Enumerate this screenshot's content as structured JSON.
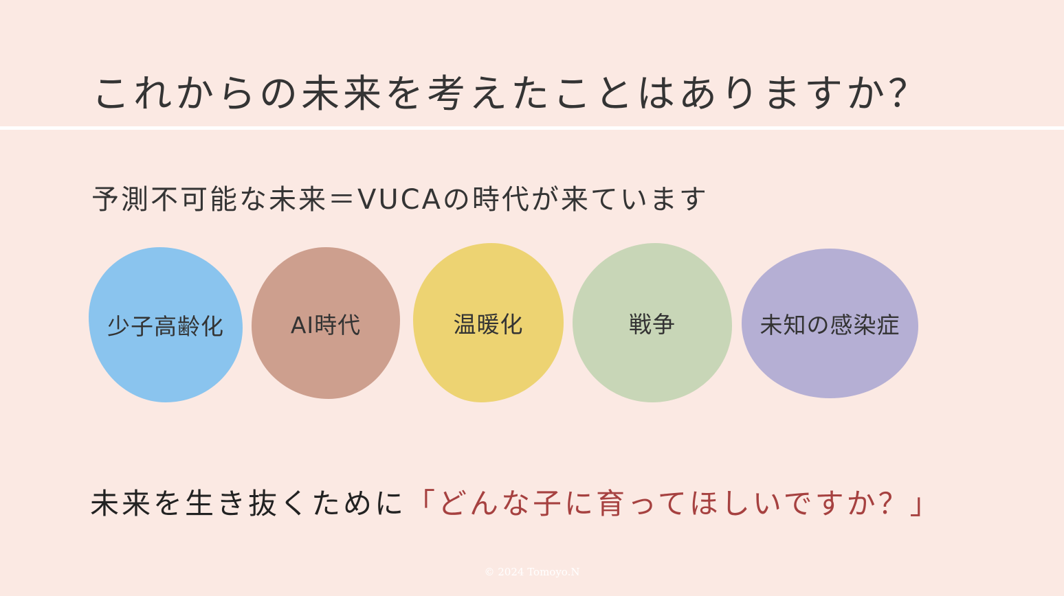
{
  "slide": {
    "title": "これからの未来を考えたことはありますか？",
    "subtitle": "予測不可能な未来＝VUCAの時代が来ています",
    "blobs": [
      {
        "label": "少子高齢化",
        "color": "#8ac4ee"
      },
      {
        "label": "AI時代",
        "color": "#cd9f8e"
      },
      {
        "label": "温暖化",
        "color": "#edd372"
      },
      {
        "label": "戦争",
        "color": "#c8d6b7"
      },
      {
        "label": "未知の感染症",
        "color": "#b5afd4"
      }
    ],
    "bottom": {
      "prefix": "未来を生き抜くために",
      "highlight": "「どんな子に育ってほしいですか？」"
    },
    "footer": "© 2024 Tomoyo.N"
  },
  "colors": {
    "background": "#fbe9e3",
    "divider": "#ffffff",
    "accent": "#a64140"
  }
}
